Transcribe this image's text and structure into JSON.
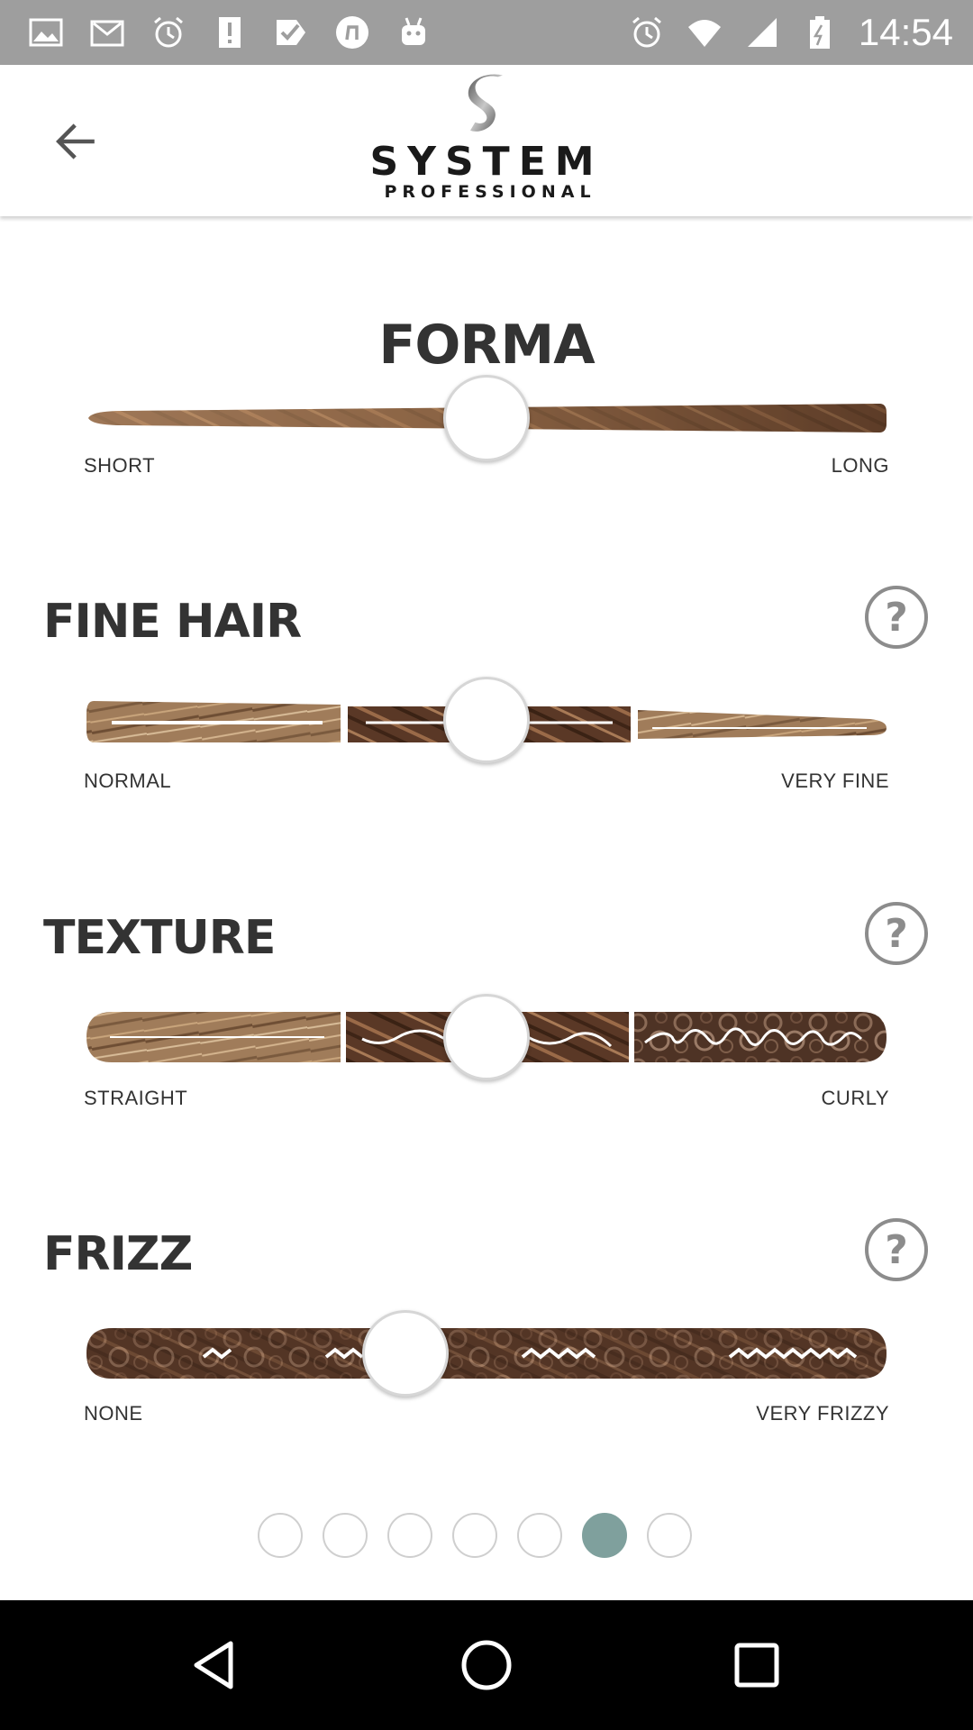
{
  "status_bar": {
    "time": "14:54",
    "left_icons": [
      "gallery-icon",
      "gmail-icon",
      "alarm-icon",
      "alert-icon",
      "task-check-icon",
      "music-icon",
      "android-icon"
    ],
    "right_icons": [
      "alarm-icon",
      "wifi-icon",
      "signal-icon",
      "battery-icon"
    ]
  },
  "app_bar": {
    "back_icon": "arrow-back-icon",
    "logo_title": "SYSTEM",
    "logo_subtitle": "PROFESSIONAL"
  },
  "sliders": [
    {
      "id": "forma",
      "title": "FORMA",
      "min_label": "SHORT",
      "max_label": "LONG",
      "value": 0.5,
      "has_help": false
    },
    {
      "id": "fine_hair",
      "title": "FINE HAIR",
      "min_label": "NORMAL",
      "max_label": "VERY FINE",
      "value": 0.5,
      "has_help": true
    },
    {
      "id": "texture",
      "title": "TEXTURE",
      "min_label": "STRAIGHT",
      "max_label": "CURLY",
      "value": 0.5,
      "has_help": true
    },
    {
      "id": "frizz",
      "title": "FRIZZ",
      "min_label": "NONE",
      "max_label": "VERY FRIZZY",
      "value": 0.4,
      "has_help": true
    }
  ],
  "help_label": "?",
  "pager": {
    "count": 7,
    "active_index": 5
  },
  "colors": {
    "accent": "#7fa09d",
    "hair_light": "#b08a64",
    "hair_dark": "#5a3a26"
  },
  "nav_bar": [
    "nav-back-icon",
    "nav-home-icon",
    "nav-recents-icon"
  ]
}
